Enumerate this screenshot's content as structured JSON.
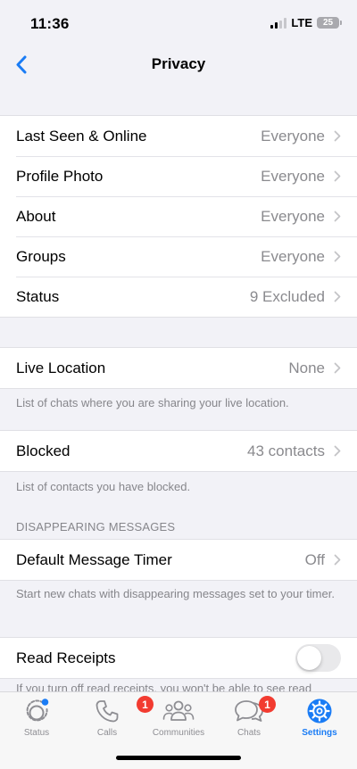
{
  "status_bar": {
    "time": "11:36",
    "network": "LTE",
    "battery": "25"
  },
  "nav": {
    "back_icon": "chevron-left-icon",
    "title": "Privacy"
  },
  "privacy_group": [
    {
      "label": "Last Seen & Online",
      "value": "Everyone"
    },
    {
      "label": "Profile Photo",
      "value": "Everyone"
    },
    {
      "label": "About",
      "value": "Everyone"
    },
    {
      "label": "Groups",
      "value": "Everyone"
    },
    {
      "label": "Status",
      "value": "9 Excluded"
    }
  ],
  "live_location": {
    "label": "Live Location",
    "value": "None",
    "footer": "List of chats where you are sharing your live location."
  },
  "blocked": {
    "label": "Blocked",
    "value": "43 contacts",
    "footer": "List of contacts you have blocked."
  },
  "disappearing": {
    "header": "DISAPPEARING MESSAGES",
    "label": "Default Message Timer",
    "value": "Off",
    "footer": "Start new chats with disappearing messages set to your timer."
  },
  "read_receipts": {
    "label": "Read Receipts",
    "enabled": false,
    "footer": "If you turn off read receipts, you won't be able to see read"
  },
  "tabs": [
    {
      "label": "Status",
      "icon": "status-ring-icon",
      "badge": "",
      "active": false
    },
    {
      "label": "Calls",
      "icon": "phone-icon",
      "badge": "1",
      "active": false
    },
    {
      "label": "Communities",
      "icon": "communities-icon",
      "badge": "",
      "active": false
    },
    {
      "label": "Chats",
      "icon": "chat-bubbles-icon",
      "badge": "1",
      "active": false
    },
    {
      "label": "Settings",
      "icon": "gear-icon",
      "badge": "",
      "active": true
    }
  ],
  "colors": {
    "accent": "#1a7cf5",
    "background": "#f2f2f7",
    "secondary_text": "#8a8a8e",
    "badge": "#f23b30"
  }
}
